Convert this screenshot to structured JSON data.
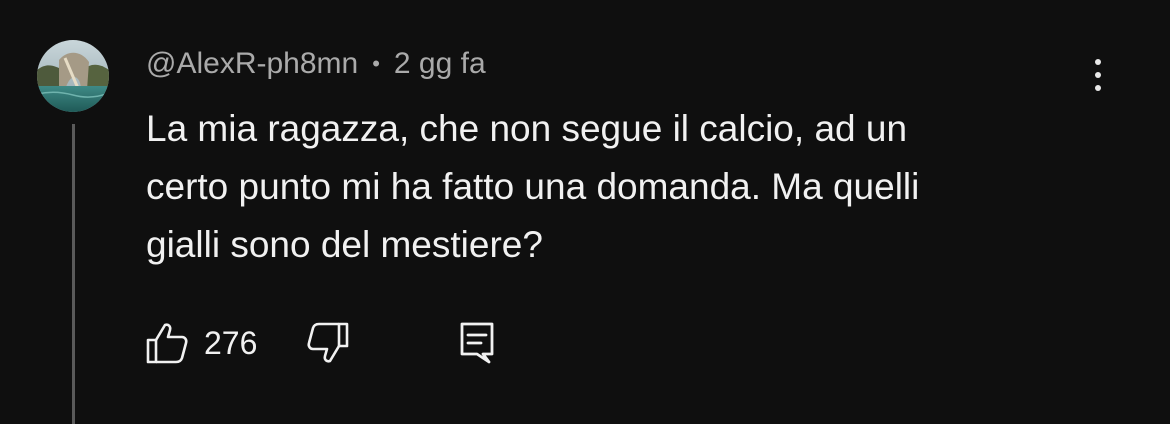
{
  "comment": {
    "author": "@AlexR-ph8mn",
    "separator": "•",
    "timestamp": "2 gg fa",
    "text_lines": [
      "La mia ragazza, che non segue il calcio, ad un",
      "certo punto mi ha fatto una domanda. Ma quelli",
      "gialli sono del mestiere?"
    ],
    "likes": "276"
  },
  "icons": {
    "like": "thumbs-up-icon",
    "dislike": "thumbs-down-icon",
    "reply": "reply-comment-icon",
    "menu": "more-vertical-icon"
  },
  "colors": {
    "background": "#0f0f0f",
    "text_primary": "#f1f1f1",
    "text_secondary": "#aaaaaa",
    "thread_line": "#5a5a5a"
  }
}
